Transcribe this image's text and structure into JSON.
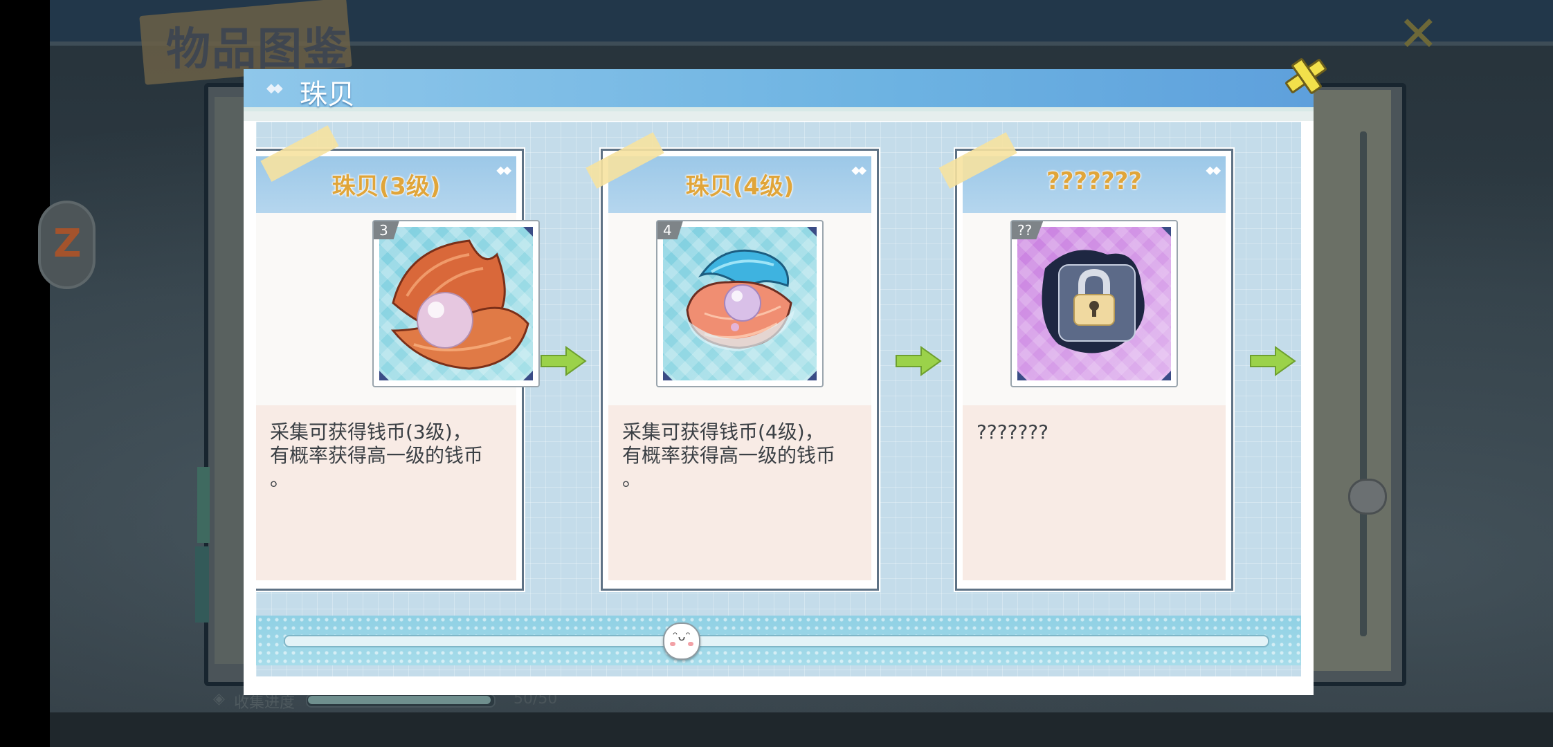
{
  "background": {
    "title": "物品图鉴",
    "progress_label": "收集进度",
    "progress_count": "50/50",
    "progress_fraction": 1.0
  },
  "modal": {
    "title": "珠贝",
    "cards": [
      {
        "name": "珠贝(3级)",
        "level": "3",
        "description": "采集可获得钱币(3级)，\n有概率获得高一级的钱币\n。",
        "item_icon": "pearl-shell-orange-icon",
        "locked": false
      },
      {
        "name": "珠贝(4级)",
        "level": "4",
        "description": "采集可获得钱币(4级)，\n有概率获得高一级的钱币\n。",
        "item_icon": "pearl-shell-blue-icon",
        "locked": false
      },
      {
        "name": "???????",
        "level": "??",
        "description": "???????",
        "item_icon": "locked-item-icon",
        "locked": true
      }
    ],
    "slider_position": 0.4
  },
  "colors": {
    "accent_header": "#6db3e2",
    "card_title": "#e0a53a",
    "arrow": "#9bd24a",
    "close_button": "#f2e04b"
  }
}
